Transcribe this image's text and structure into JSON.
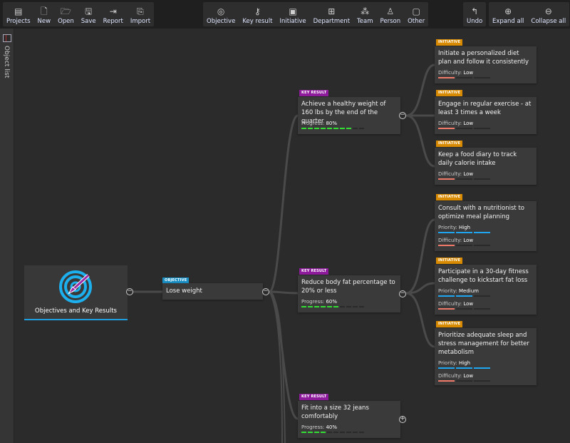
{
  "toolbar": {
    "file": [
      {
        "label": "Projects",
        "icon": "projects-icon",
        "g": "▤"
      },
      {
        "label": "New",
        "icon": "new-file-icon",
        "g": "🗋"
      },
      {
        "label": "Open",
        "icon": "folder-open-icon",
        "g": "🗁"
      },
      {
        "label": "Save",
        "icon": "save-icon",
        "g": "🖫"
      },
      {
        "label": "Report",
        "icon": "report-icon",
        "g": "⇥"
      },
      {
        "label": "Import",
        "icon": "import-icon",
        "g": "⎘"
      }
    ],
    "insert": [
      {
        "label": "Objective",
        "icon": "objective-icon",
        "g": "◎"
      },
      {
        "label": "Key result",
        "icon": "key-icon",
        "g": "⚷"
      },
      {
        "label": "Initiative",
        "icon": "initiative-icon",
        "g": "▣"
      },
      {
        "label": "Department",
        "icon": "department-icon",
        "g": "⊞"
      },
      {
        "label": "Team",
        "icon": "team-icon",
        "g": "⁂"
      },
      {
        "label": "Person",
        "icon": "person-icon",
        "g": "♙"
      },
      {
        "label": "Other",
        "icon": "other-icon",
        "g": "▢"
      }
    ],
    "undo": [
      {
        "label": "Undo",
        "icon": "undo-icon",
        "g": "↰"
      }
    ],
    "expand": [
      {
        "label": "Expand all",
        "icon": "expand-all-icon",
        "g": "⊕"
      },
      {
        "label": "Collapse all",
        "icon": "collapse-all-icon",
        "g": "⊖"
      }
    ]
  },
  "sidebar": {
    "label": "Object list"
  },
  "root": {
    "label": "Objectives and Key Results"
  },
  "objective": {
    "tag": "OBJECTIVE",
    "title": "Lose weight"
  },
  "key_results": [
    {
      "tag": "KEY RESULT",
      "title": "Achieve a healthy weight of 160 lbs by the end of the quarter",
      "progress_label": "Progress:",
      "progress": "80%",
      "progress_value": 80,
      "expanded": true
    },
    {
      "tag": "KEY RESULT",
      "title": "Reduce body fat percentage to 20% or less",
      "progress_label": "Progress:",
      "progress": "60%",
      "progress_value": 60,
      "expanded": true
    },
    {
      "tag": "KEY RESULT",
      "title": "Fit into a size 32 jeans comfortably",
      "progress_label": "Progress:",
      "progress": "40%",
      "progress_value": 40,
      "expanded": false
    }
  ],
  "initiatives": [
    {
      "tag": "INITIATIVE",
      "title": "Initiate a personalized diet plan and follow it consistently",
      "difficulty_label": "Difficulty:",
      "difficulty": "Low",
      "difficulty_level": 1
    },
    {
      "tag": "INITIATIVE",
      "title": "Engage in regular exercise - at least 3 times a week",
      "difficulty_label": "Difficulty:",
      "difficulty": "Low",
      "difficulty_level": 1
    },
    {
      "tag": "INITIATIVE",
      "title": "Keep a food diary to track daily calorie intake",
      "difficulty_label": "Difficulty:",
      "difficulty": "Low",
      "difficulty_level": 1
    },
    {
      "tag": "INITIATIVE",
      "title": "Consult with a nutritionist to optimize meal planning",
      "priority_label": "Priority:",
      "priority": "High",
      "priority_level": 3,
      "difficulty_label": "Difficulty:",
      "difficulty": "Low",
      "difficulty_level": 1
    },
    {
      "tag": "INITIATIVE",
      "title": "Participate in a 30-day fitness challenge to kickstart fat loss",
      "priority_label": "Priority:",
      "priority": "Medium",
      "priority_level": 2,
      "difficulty_label": "Difficulty:",
      "difficulty": "Low",
      "difficulty_level": 1
    },
    {
      "tag": "INITIATIVE",
      "title": "Prioritize adequate sleep and stress management for better metabolism",
      "priority_label": "Priority:",
      "priority": "High",
      "priority_level": 3,
      "difficulty_label": "Difficulty:",
      "difficulty": "Low",
      "difficulty_level": 1
    }
  ],
  "colors": {
    "objective": "#1a8fc4",
    "key_result": "#8e1b9c",
    "initiative": "#d88a00",
    "progress": "#33dd33",
    "priority": "#1ea7f0",
    "difficulty": "#f07a6a",
    "accent": "#1d9fe0"
  }
}
